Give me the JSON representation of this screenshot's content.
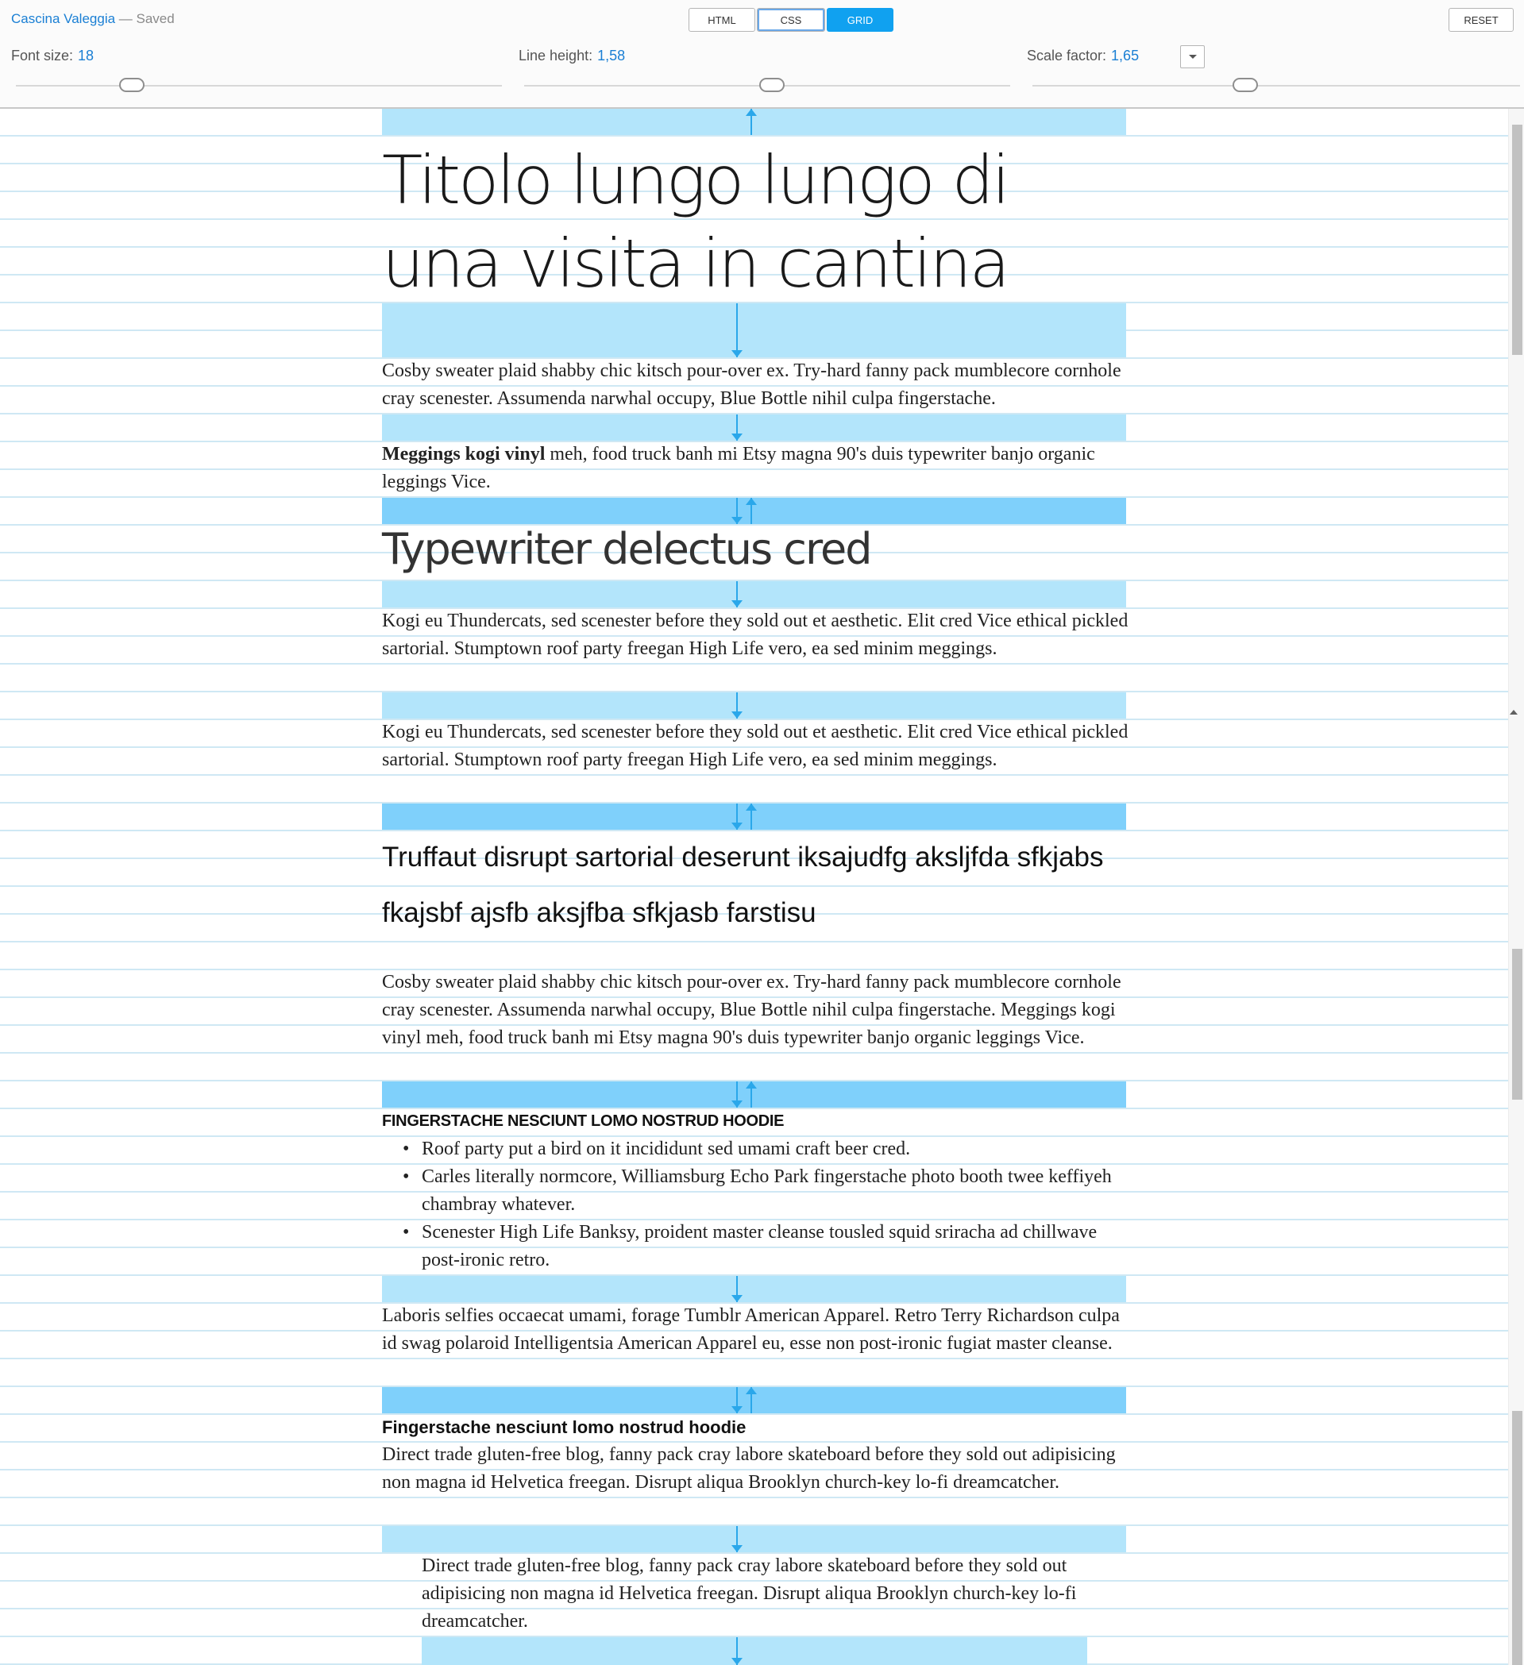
{
  "header": {
    "doc_name": "Cascina Valeggia",
    "separator": "—",
    "status": "Saved",
    "modes": [
      "HTML",
      "CSS",
      "GRID"
    ],
    "active_mode": "GRID",
    "reset_label": "RESET"
  },
  "controls": {
    "font_size": {
      "label": "Font size:",
      "value": "18"
    },
    "line_height": {
      "label": "Line height:",
      "value": "1,58"
    },
    "scale_factor": {
      "label": "Scale factor:",
      "value": "1,65"
    }
  },
  "colors": {
    "accent": "#1a7fd4",
    "grid_button": "#10a1f0",
    "margin_band": "#b3e5fb",
    "margin_band_strong": "#7fd0fb",
    "arrow": "#2aa7ea",
    "baseline": "#cfe8f4"
  },
  "icons": [
    "chevron-down-icon",
    "arrow-down-icon",
    "arrow-up-icon"
  ],
  "content": {
    "h1_line1": "Titolo lungo lungo di",
    "h1_line2": "una visita in cantina",
    "p1": "Cosby sweater plaid shabby chic kitsch pour-over ex. Try-hard fanny pack mumblecore cornhole cray scenester. Assumenda narwhal occupy, Blue Bottle nihil culpa fingerstache.",
    "p2_bold": "Meggings kogi vinyl",
    "p2_rest": " meh, food truck banh mi Etsy magna 90's duis typewriter banjo organic leggings Vice.",
    "h2": "Typewriter delectus cred",
    "p3": "Kogi eu Thundercats, sed scenester before they sold out et aesthetic. Elit cred Vice ethical pickled sartorial. Stumptown roof party freegan High Life vero, ea sed minim meggings.",
    "p4": "Kogi eu Thundercats, sed scenester before they sold out et aesthetic. Elit cred Vice ethical pickled sartorial. Stumptown roof party freegan High Life vero, ea sed minim meggings.",
    "h3": "Truffaut disrupt sartorial deserunt iksajudfg aksljfda sfkjabs fkajsbf ajsfb aksjfba sfkjasb farstisu",
    "p5": "Cosby sweater plaid shabby chic kitsch pour-over ex. Try-hard fanny pack mumblecore cornhole cray scenester. Assumenda narwhal occupy, Blue Bottle nihil culpa fingerstache. Meggings kogi vinyl meh, food truck banh mi Etsy magna 90's duis typewriter banjo organic leggings Vice.",
    "h4_caps": "FINGERSTACHE NESCIUNT LOMO NOSTRUD HOODIE",
    "list": [
      "Roof party put a bird on it incididunt sed umami craft beer cred.",
      "Carles literally normcore, Williamsburg Echo Park fingerstache photo booth twee keffiyeh chambray whatever.",
      "Scenester High Life Banksy, proident master cleanse tousled squid sriracha ad chillwave post-ironic retro."
    ],
    "p6": "Laboris selfies occaecat umami, forage Tumblr American Apparel. Retro Terry Richardson culpa id swag polaroid Intelligentsia American Apparel eu, esse non post-ironic fugiat master cleanse.",
    "h4": "Fingerstache nesciunt lomo nostrud hoodie",
    "p7": "Direct trade gluten-free blog, fanny pack cray labore skateboard before they sold out adipisicing non magna id Helvetica freegan. Disrupt aliqua Brooklyn church-key lo-fi dreamcatcher.",
    "blockquote": "Direct trade gluten-free blog, fanny pack cray labore skateboard before they sold out adipisicing non magna id Helvetica freegan. Disrupt aliqua Brooklyn church-key lo-fi dreamcatcher."
  }
}
